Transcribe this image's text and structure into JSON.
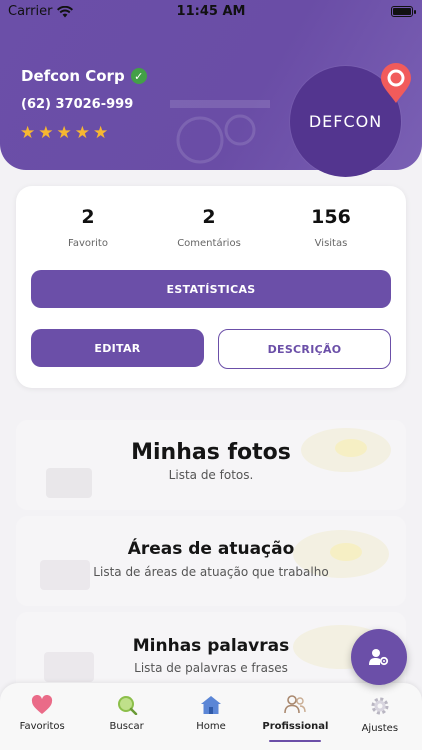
{
  "status_bar": {
    "carrier": "Carrier",
    "time": "11:45 AM"
  },
  "profile": {
    "name": "Defcon Corp",
    "phone": "(62) 37026-999",
    "rating": 5,
    "avatar_text": "DEFCON",
    "verified_icon": "verified-check-icon",
    "pin_icon": "location-pin-icon"
  },
  "stats": [
    {
      "value": "2",
      "label": "Favorito"
    },
    {
      "value": "2",
      "label": "Comentários"
    },
    {
      "value": "156",
      "label": "Visitas"
    }
  ],
  "buttons": {
    "statistics": "ESTATÍSTICAS",
    "edit": "EDITAR",
    "description": "DESCRIÇÃO"
  },
  "sections": [
    {
      "title": "Minhas fotos",
      "subtitle": "Lista de fotos."
    },
    {
      "title": "Áreas de atuação",
      "subtitle": "Lista de áreas de atuação que trabalho"
    },
    {
      "title": "Minhas palavras",
      "subtitle": "Lista de palavras e frases"
    }
  ],
  "fab": {
    "icon": "user-settings-icon"
  },
  "tabs": [
    {
      "label": "Favoritos",
      "icon": "heart-icon",
      "active": false
    },
    {
      "label": "Buscar",
      "icon": "search-icon",
      "active": false
    },
    {
      "label": "Home",
      "icon": "home-icon",
      "active": false
    },
    {
      "label": "Profissional",
      "icon": "users-icon",
      "active": true
    },
    {
      "label": "Ajustes",
      "icon": "gear-icon",
      "active": false
    }
  ],
  "colors": {
    "primary": "#6b4fa8",
    "avatar": "#53358f",
    "star": "#f7b731",
    "verified": "#43a047",
    "pin": "#f15b5b"
  }
}
